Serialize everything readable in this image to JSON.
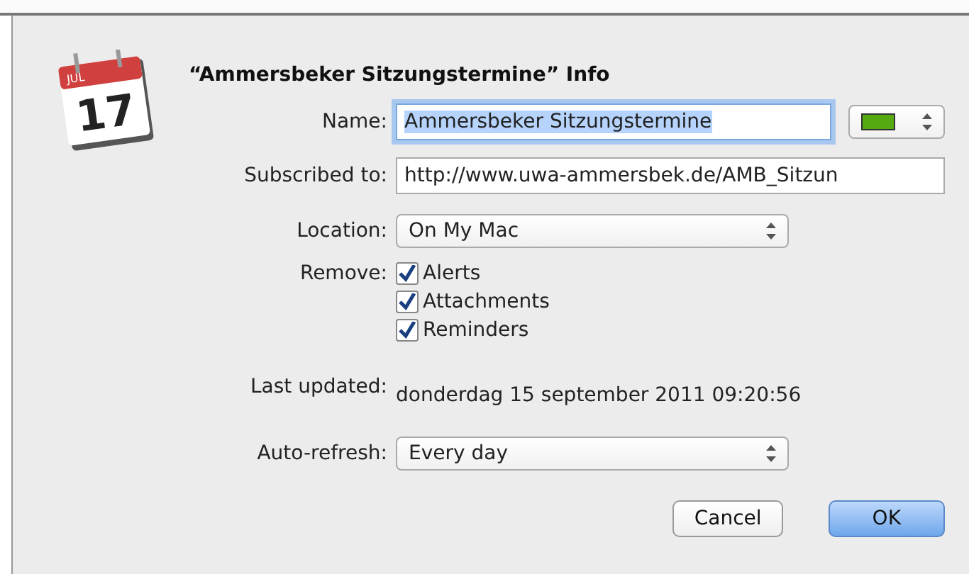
{
  "dialog": {
    "title": "“Ammersbeker Sitzungstermine” Info",
    "icon": {
      "month": "JUL",
      "day": "17"
    },
    "name": {
      "label": "Name:",
      "value": "Ammersbeker Sitzungstermine",
      "selected": true,
      "color": "#55aa11"
    },
    "subscribed": {
      "label": "Subscribed to:",
      "value": "http://www.uwa-ammersbek.de/AMB_Sitzun"
    },
    "location": {
      "label": "Location:",
      "value": "On My Mac"
    },
    "remove": {
      "label": "Remove:",
      "options": [
        {
          "label": "Alerts",
          "checked": true
        },
        {
          "label": "Attachments",
          "checked": true
        },
        {
          "label": "Reminders",
          "checked": true
        }
      ]
    },
    "last_updated": {
      "label": "Last updated:",
      "value": "donderdag 15 september 2011 09:20:56"
    },
    "auto_refresh": {
      "label": "Auto-refresh:",
      "value": "Every day"
    },
    "buttons": [
      {
        "label": "Cancel",
        "default": false
      },
      {
        "label": "OK",
        "default": true
      }
    ]
  }
}
